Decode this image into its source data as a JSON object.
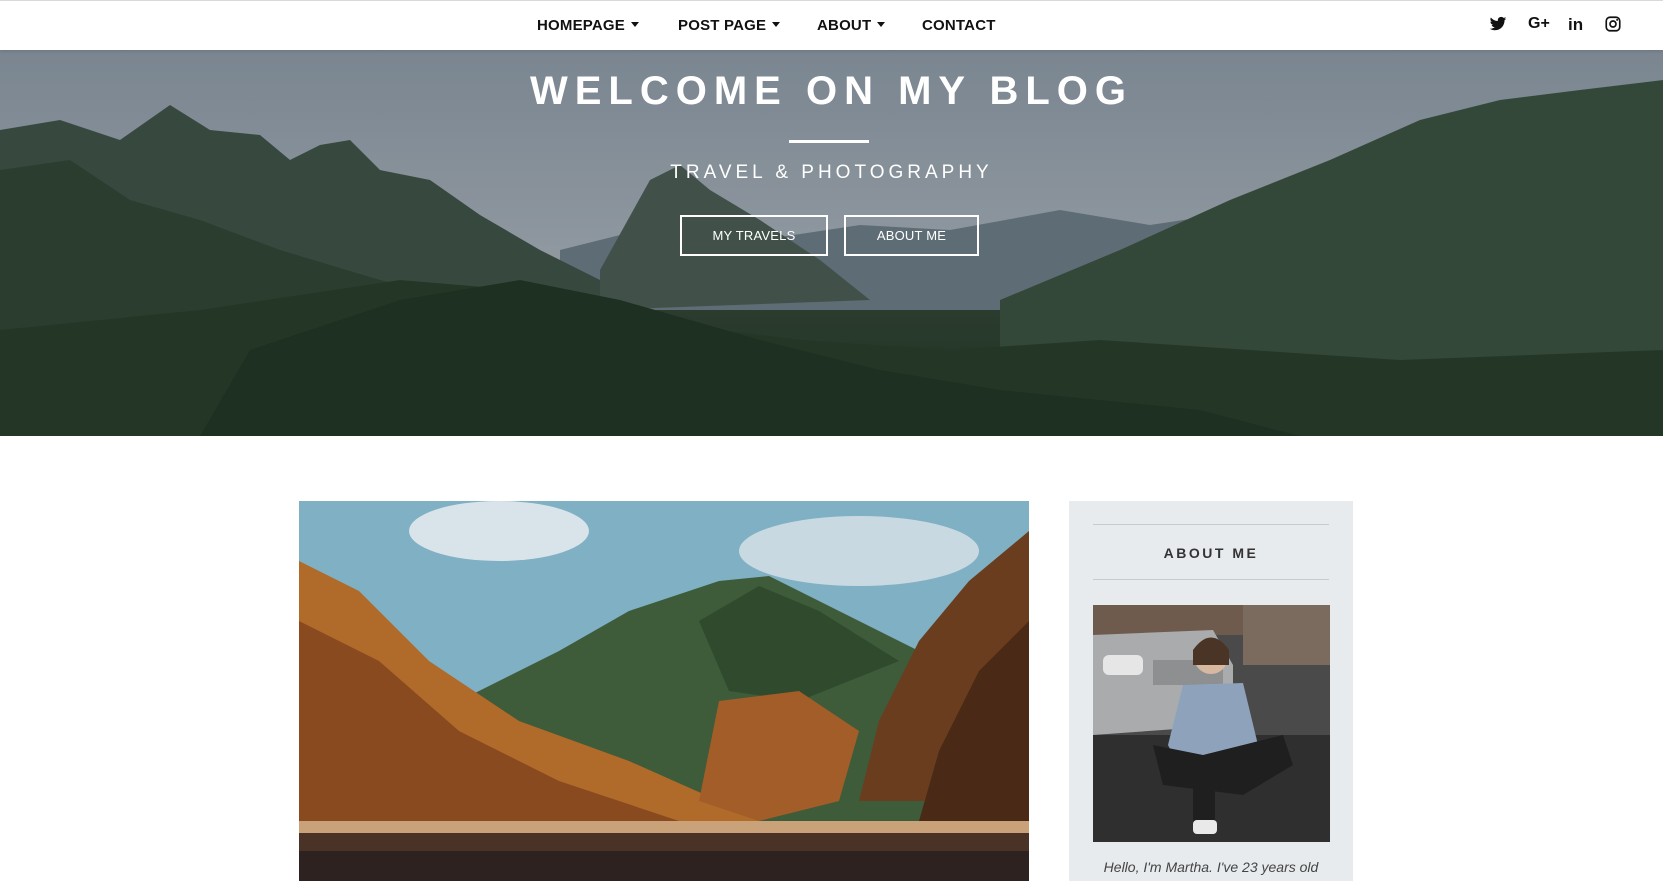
{
  "nav": {
    "items": [
      {
        "label": "HOMEPAGE",
        "dropdown": true
      },
      {
        "label": "POST PAGE",
        "dropdown": true
      },
      {
        "label": "ABOUT",
        "dropdown": true
      },
      {
        "label": "CONTACT",
        "dropdown": false
      }
    ],
    "social": [
      "twitter-icon",
      "google-plus-icon",
      "linkedin-icon",
      "instagram-icon"
    ],
    "social_text": {
      "google_plus": "G+",
      "linkedin": "in"
    }
  },
  "hero": {
    "title": "WELCOME ON MY BLOG",
    "subtitle": "TRAVEL & PHOTOGRAPHY",
    "buttons": {
      "travels": "MY TRAVELS",
      "about": "ABOUT ME"
    }
  },
  "sidebar": {
    "title": "ABOUT ME",
    "text": "Hello, I'm Martha. I've 23 years old"
  },
  "colors": {
    "nav_bg": "#ffffff",
    "hero_text": "#ffffff",
    "sidebar_bg": "#e8ebee"
  }
}
